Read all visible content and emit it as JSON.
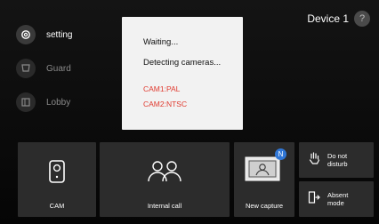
{
  "menu": {
    "items": [
      {
        "label": "setting",
        "icon": "gear-icon"
      },
      {
        "label": "Guard",
        "icon": "guard-icon"
      },
      {
        "label": "Lobby",
        "icon": "lobby-icon"
      }
    ]
  },
  "device": {
    "name": "Device 1",
    "help": "?"
  },
  "dialog": {
    "line1": "Waiting...",
    "line2": "Detecting cameras...",
    "cam1": "CAM1:PAL",
    "cam2": "CAM2:NTSC"
  },
  "tiles": {
    "cam": "CAM",
    "internal_call": "Internal call",
    "new_capture": "New capture",
    "capture_badge": "N",
    "do_not_disturb_line1": "Do not",
    "do_not_disturb_line2": "disturb",
    "absent_line1": "Absent",
    "absent_line2": "mode"
  },
  "colors": {
    "accent_red": "#e03a2f",
    "badge_blue": "#2f76d6"
  }
}
